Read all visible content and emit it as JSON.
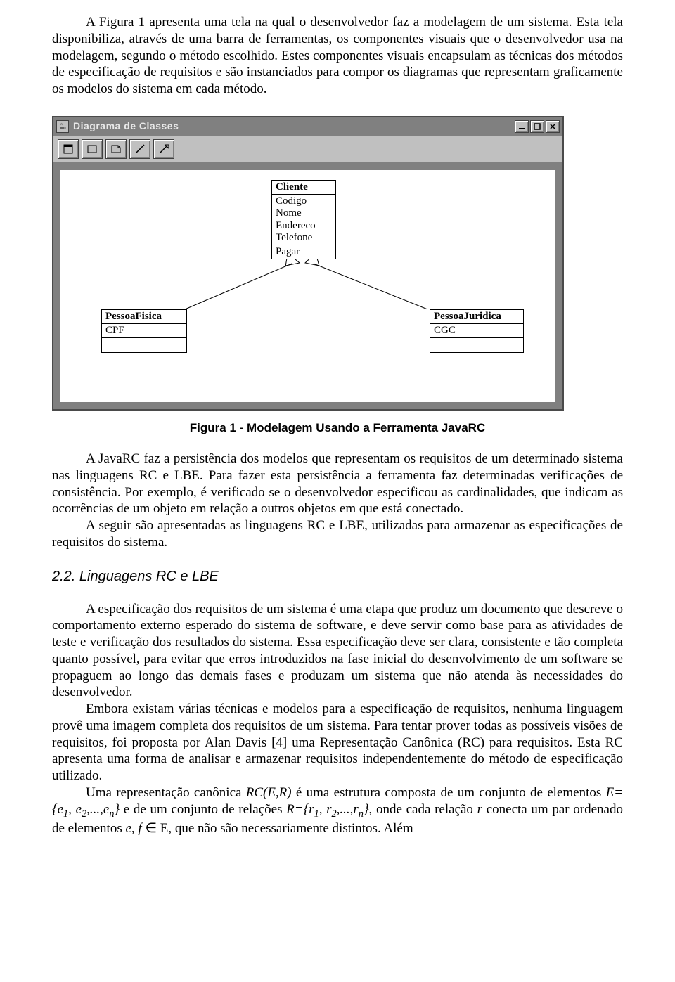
{
  "para1": "A Figura 1 apresenta uma tela na qual o desenvolvedor faz a modelagem de um sistema. Esta tela disponibiliza, através de uma barra de ferramentas, os componentes visuais que o desenvolvedor usa na modelagem, segundo o método escolhido. Estes componentes visuais encapsulam as técnicas dos métodos de especificação de requisitos e são instanciados para compor os diagramas que representam graficamente os modelos do sistema em cada método.",
  "window": {
    "title": "Diagrama de Classes",
    "toolbar": {
      "b1": "select-tool",
      "b2": "class-tool",
      "b3": "note-tool",
      "b4": "association-tool",
      "b5": "generalization-tool"
    },
    "classes": {
      "cliente": {
        "name": "Cliente",
        "attrs": [
          "Codigo",
          "Nome",
          "Endereco",
          "Telefone"
        ],
        "ops": [
          "Pagar"
        ]
      },
      "pf": {
        "name": "PessoaFisica",
        "attrs": [
          "CPF"
        ],
        "ops": []
      },
      "pj": {
        "name": "PessoaJuridica",
        "attrs": [
          "CGC"
        ],
        "ops": []
      }
    }
  },
  "caption": "Figura 1 - Modelagem Usando a Ferramenta JavaRC",
  "para2": "A JavaRC faz a persistência dos modelos que representam os requisitos de um determinado sistema nas linguagens RC e LBE. Para fazer esta persistência a ferramenta faz determinadas verificações de consistência. Por exemplo, é verificado se o desenvolvedor especificou as cardinalidades, que indicam as ocorrências de um objeto em relação a outros objetos em que está conectado.",
  "para3": "A seguir são apresentadas as linguagens RC e LBE, utilizadas para armazenar as especificações de requisitos do sistema.",
  "heading22": "2.2. Linguagens RC e LBE",
  "para4": "A especificação dos requisitos de um sistema é uma etapa que produz um documento que descreve o comportamento externo esperado do sistema de software, e deve servir como base para as atividades de teste e verificação dos resultados do sistema. Essa especificação deve ser clara, consistente e tão completa quanto possível, para evitar que erros introduzidos na fase inicial do desenvolvimento de um software se propaguem ao longo das demais fases e produzam um sistema que não atenda às necessidades do desenvolvedor.",
  "para5": "Embora existam várias técnicas e modelos para a especificação de requisitos, nenhuma linguagem provê uma imagem completa dos requisitos de um sistema. Para tentar prover todas as possíveis visões de requisitos, foi proposta por Alan Davis [4] uma Representação Canônica (RC) para requisitos. Esta RC apresenta uma forma de analisar e armazenar requisitos independentemente do método de especificação utilizado.",
  "para6_a": "Uma representação canônica ",
  "para6_b": " é uma estrutura composta de um conjunto de elementos ",
  "para6_c": " e de um conjunto de relações ",
  "para6_d": ", onde cada relação ",
  "para6_e": " conecta um par ordenado de elementos ",
  "para6_f": ", que não são necessariamente distintos. Além",
  "math": {
    "rc_er": "RC(E,R)",
    "eset_open": "E={e",
    "eset_mid": ", e",
    "eset_ell": ",...,e",
    "eset_close": "}",
    "rset_open": "R={r",
    "rset_mid": ", r",
    "rset_ell": ",...,r",
    "rset_close": "}",
    "r": "r",
    "ef": "e, f",
    "inE": " ∈ E",
    "s1": "1",
    "s2": "2",
    "sn": "n"
  }
}
